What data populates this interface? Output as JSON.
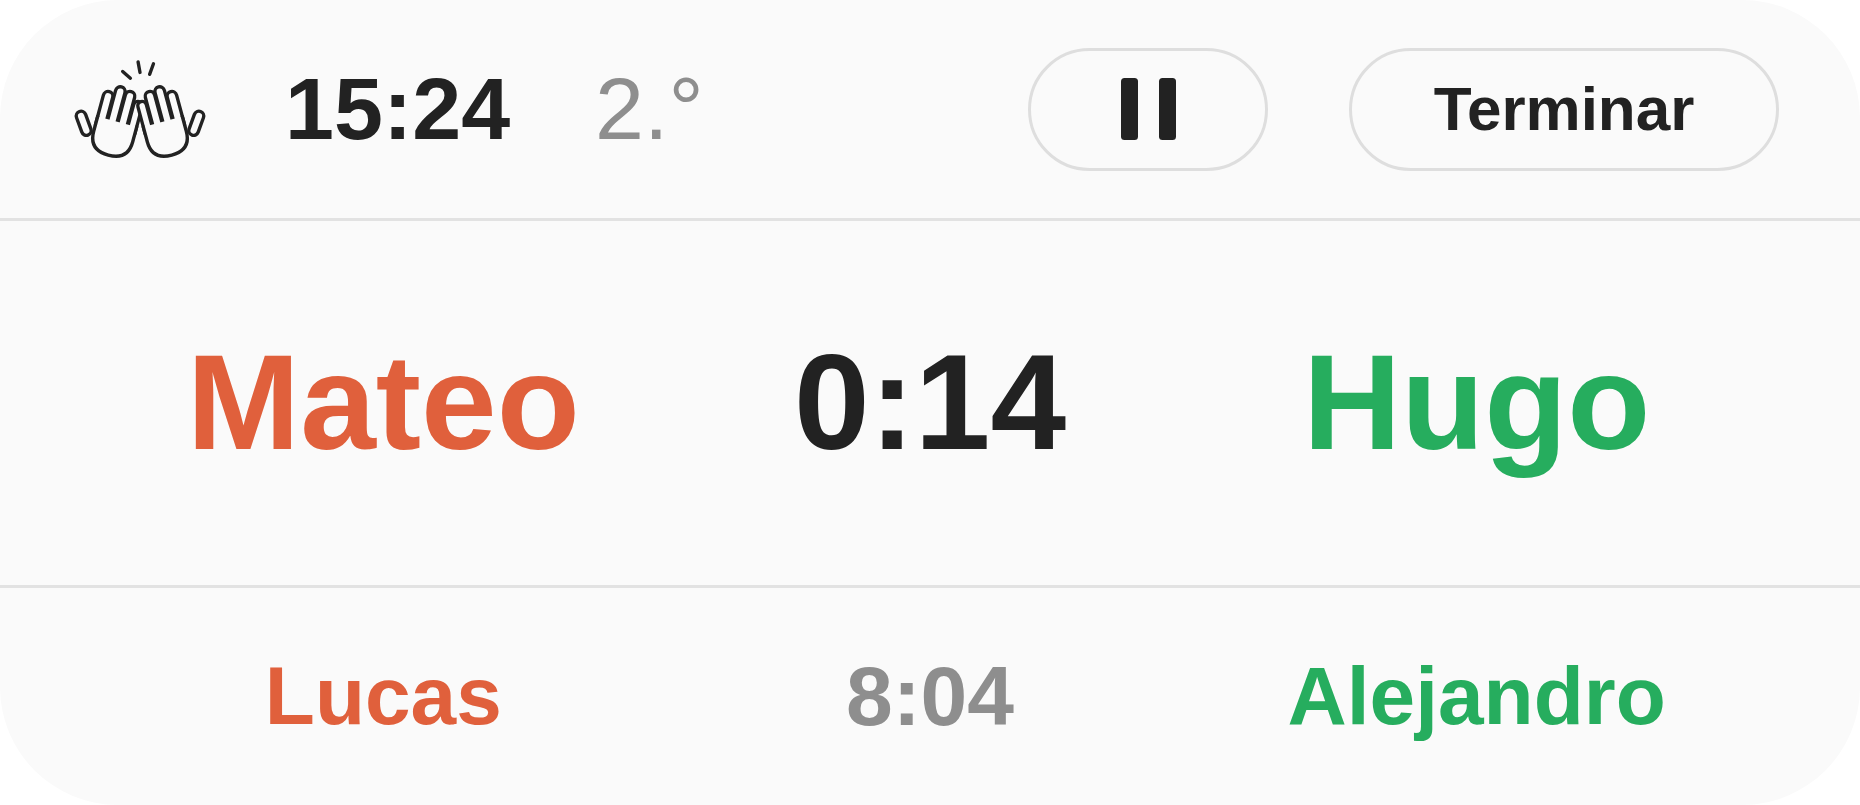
{
  "header": {
    "time": "15:24",
    "period": "2.°",
    "buttons": [
      {
        "kind": "pause"
      },
      {
        "kind": "text",
        "label": "Terminar"
      }
    ]
  },
  "current_match": {
    "players": [
      {
        "name": "Mateo",
        "color": "#e0603c"
      },
      {
        "name": "Hugo",
        "color": "#26ad5e"
      }
    ],
    "timer": "0:14"
  },
  "next_match": {
    "players": [
      {
        "name": "Lucas",
        "color": "#e0603c"
      },
      {
        "name": "Alejandro",
        "color": "#26ad5e"
      }
    ],
    "timer": "8:04"
  }
}
